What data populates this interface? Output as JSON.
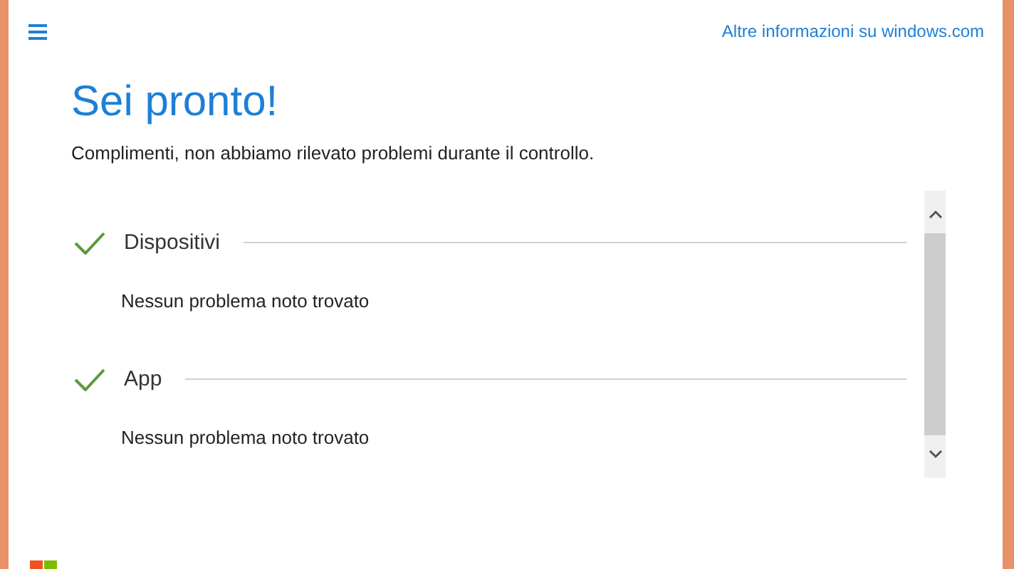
{
  "header": {
    "link": "Altre informazioni su windows.com"
  },
  "title": "Sei pronto!",
  "subtitle": "Complimenti, non abbiamo rilevato problemi durante il controllo.",
  "results": [
    {
      "name": "Dispositivi",
      "passed": true,
      "detail": "Nessun problema noto trovato"
    },
    {
      "name": "App",
      "passed": true,
      "detail": "Nessun problema noto trovato"
    }
  ]
}
